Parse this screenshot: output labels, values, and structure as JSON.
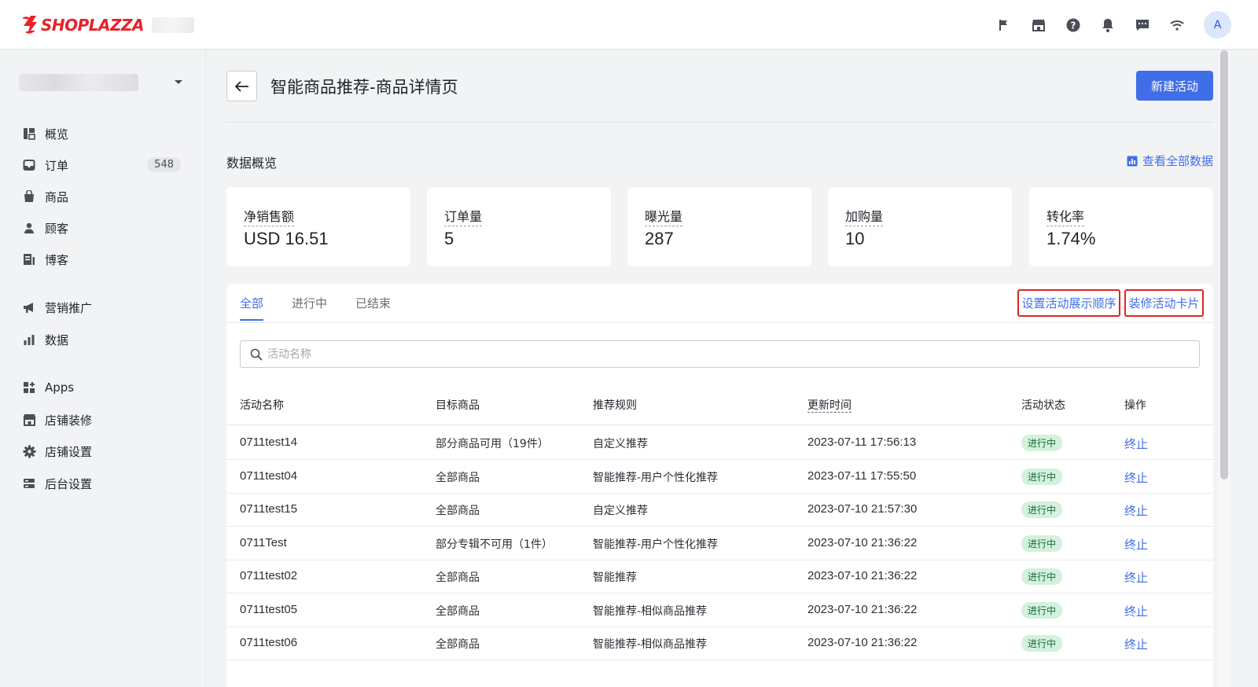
{
  "brand": {
    "name": "SHOPLAZZA",
    "color": "#e8212a"
  },
  "topbar": {
    "icons": [
      "flag-icon",
      "store-icon",
      "help-icon",
      "bell-icon",
      "message-icon",
      "wifi-icon"
    ],
    "avatar_letter": "A"
  },
  "sidebar": {
    "items": [
      {
        "label": "概览",
        "icon": "overview-icon"
      },
      {
        "label": "订单",
        "icon": "inbox-icon",
        "count": "548"
      },
      {
        "label": "商品",
        "icon": "bag-icon"
      },
      {
        "label": "顾客",
        "icon": "person-icon"
      },
      {
        "label": "博客",
        "icon": "blog-icon"
      },
      {
        "label": "营销推广",
        "icon": "megaphone-icon"
      },
      {
        "label": "数据",
        "icon": "bar-chart-icon"
      },
      {
        "label": "Apps",
        "icon": "apps-icon"
      },
      {
        "label": "店铺装修",
        "icon": "shop-icon"
      },
      {
        "label": "店铺设置",
        "icon": "gear-icon"
      },
      {
        "label": "后台设置",
        "icon": "server-icon"
      }
    ]
  },
  "header": {
    "title": "智能商品推荐-商品详情页",
    "new_button": "新建活动"
  },
  "overview": {
    "title": "数据概览",
    "view_all": "查看全部数据",
    "stats": [
      {
        "label": "净销售额",
        "value": "USD 16.51"
      },
      {
        "label": "订单量",
        "value": "5"
      },
      {
        "label": "曝光量",
        "value": "287"
      },
      {
        "label": "加购量",
        "value": "10"
      },
      {
        "label": "转化率",
        "value": "1.74%"
      }
    ]
  },
  "panel": {
    "tabs": [
      "全部",
      "进行中",
      "已结束"
    ],
    "active_tab": "全部",
    "actions": {
      "order": "设置活动展示顺序",
      "decorate": "装修活动卡片"
    },
    "search_placeholder": "活动名称",
    "columns": [
      "活动名称",
      "目标商品",
      "推荐规则",
      "更新时间",
      "活动状态",
      "操作"
    ],
    "rows": [
      {
        "name": "0711test14",
        "target": "部分商品可用（19件）",
        "rule": "自定义推荐",
        "updated": "2023-07-11 17:56:13",
        "status": "进行中",
        "op": "终止"
      },
      {
        "name": "0711test04",
        "target": "全部商品",
        "rule": "智能推荐-用户个性化推荐",
        "updated": "2023-07-11 17:55:50",
        "status": "进行中",
        "op": "终止"
      },
      {
        "name": "0711test15",
        "target": "全部商品",
        "rule": "自定义推荐",
        "updated": "2023-07-10 21:57:30",
        "status": "进行中",
        "op": "终止"
      },
      {
        "name": "0711Test",
        "target": "部分专辑不可用（1件）",
        "rule": "智能推荐-用户个性化推荐",
        "updated": "2023-07-10 21:36:22",
        "status": "进行中",
        "op": "终止"
      },
      {
        "name": "0711test02",
        "target": "全部商品",
        "rule": "智能推荐",
        "updated": "2023-07-10 21:36:22",
        "status": "进行中",
        "op": "终止"
      },
      {
        "name": "0711test05",
        "target": "全部商品",
        "rule": "智能推荐-相似商品推荐",
        "updated": "2023-07-10 21:36:22",
        "status": "进行中",
        "op": "终止"
      },
      {
        "name": "0711test06",
        "target": "全部商品",
        "rule": "智能推荐-相似商品推荐",
        "updated": "2023-07-10 21:36:22",
        "status": "进行中",
        "op": "终止"
      }
    ]
  },
  "colors": {
    "primary": "#3f6ee8",
    "status_bg": "#d3f1dc",
    "highlight_border": "#e02424"
  }
}
